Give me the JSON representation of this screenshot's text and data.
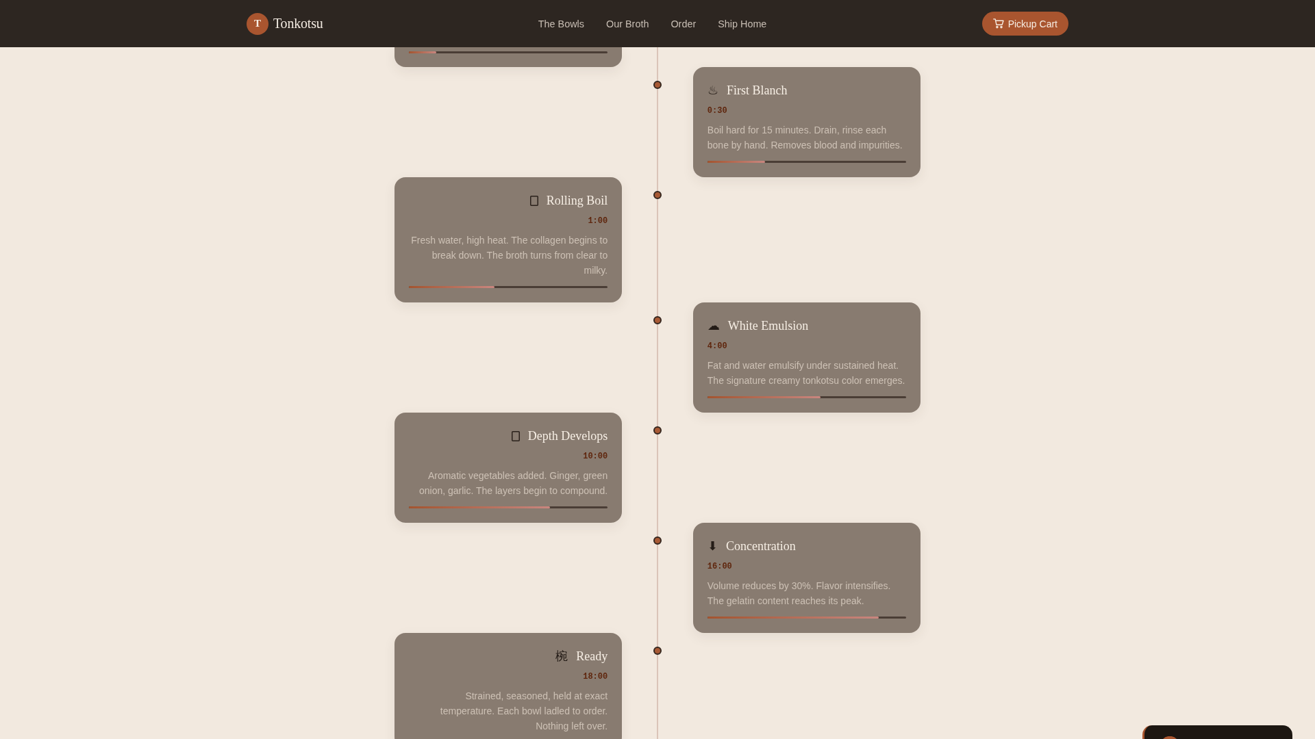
{
  "header": {
    "logo_letter": "T",
    "brand": "Tonkotsu",
    "nav": [
      "The Bowls",
      "Our Broth",
      "Order",
      "Ship Home"
    ],
    "cart_button": "Pickup Cart"
  },
  "timeline": {
    "clipped_step": {
      "level": 0.14
    },
    "steps": [
      {
        "icon": {
          "kind": "steam",
          "glyph": "♨"
        },
        "title": "First Blanch",
        "time": "0:30",
        "description": "Boil hard for 15 minutes. Drain, rinse each bone by hand. Removes blood and impurities.",
        "level": 0.29
      },
      {
        "icon": {
          "kind": "box"
        },
        "title": "Rolling Boil",
        "time": "1:00",
        "description": "Fresh water, high heat. The collagen begins to break down. The broth turns from clear to milky.",
        "level": 0.43
      },
      {
        "icon": {
          "kind": "cloud",
          "glyph": "☁"
        },
        "title": "White Emulsion",
        "time": "4:00",
        "description": "Fat and water emulsify under sustained heat. The signature creamy tonkotsu color emerges.",
        "level": 0.57
      },
      {
        "icon": {
          "kind": "box"
        },
        "title": "Depth Develops",
        "time": "10:00",
        "description": "Aromatic vegetables added. Ginger, green onion, garlic. The layers begin to compound.",
        "level": 0.71
      },
      {
        "icon": {
          "kind": "arrow",
          "glyph": "⬇"
        },
        "title": "Concentration",
        "time": "16:00",
        "description": "Volume reduces by 30%. Flavor intensifies. The gelatin content reaches its peak.",
        "level": 0.86
      },
      {
        "icon": {
          "kind": "kanji",
          "glyph": "椀"
        },
        "title": "Ready",
        "time": "18:00",
        "description": "Strained, seasoned, held at exact temperature. Each bowl ladled to order. Nothing left over."
      }
    ]
  }
}
